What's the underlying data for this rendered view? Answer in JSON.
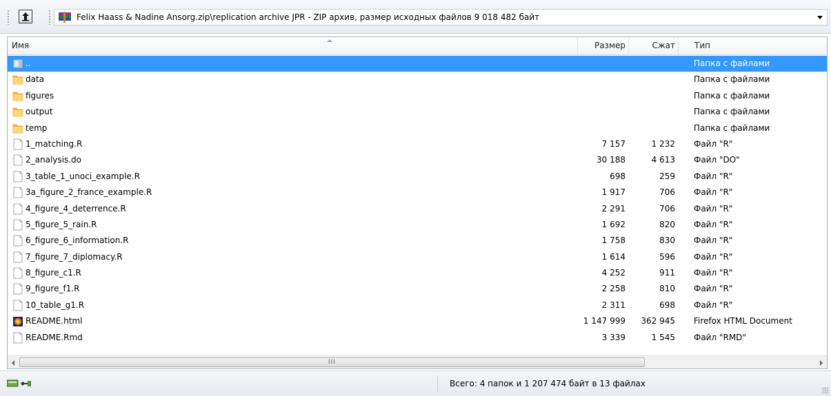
{
  "toolbar": {
    "path": "Felix Haass & Nadine Ansorg.zip\\replication archive JPR - ZIP архив, размер исходных файлов 9 018 482 байт",
    "up_icon": "up-folder-icon",
    "archive_icon": "winrar-archive-icon"
  },
  "columns": {
    "name": "Имя",
    "size": "Размер",
    "packed": "Сжат",
    "type": "Тип"
  },
  "files": [
    {
      "name": "..",
      "size": "",
      "packed": "",
      "type": "Папка с файлами",
      "icon": "parent-folder-icon",
      "selected": true
    },
    {
      "name": "data",
      "size": "",
      "packed": "",
      "type": "Папка с файлами",
      "icon": "folder-icon"
    },
    {
      "name": "figures",
      "size": "",
      "packed": "",
      "type": "Папка с файлами",
      "icon": "folder-icon"
    },
    {
      "name": "output",
      "size": "",
      "packed": "",
      "type": "Папка с файлами",
      "icon": "folder-icon"
    },
    {
      "name": "temp",
      "size": "",
      "packed": "",
      "type": "Папка с файлами",
      "icon": "folder-icon"
    },
    {
      "name": "1_matching.R",
      "size": "7 157",
      "packed": "1 232",
      "type": "Файл \"R\"",
      "icon": "file-icon"
    },
    {
      "name": "2_analysis.do",
      "size": "30 188",
      "packed": "4 613",
      "type": "Файл \"DO\"",
      "icon": "file-icon"
    },
    {
      "name": "3_table_1_unoci_example.R",
      "size": "698",
      "packed": "259",
      "type": "Файл \"R\"",
      "icon": "file-icon"
    },
    {
      "name": "3a_figure_2_france_example.R",
      "size": "1 917",
      "packed": "706",
      "type": "Файл \"R\"",
      "icon": "file-icon"
    },
    {
      "name": "4_figure_4_deterrence.R",
      "size": "2 291",
      "packed": "706",
      "type": "Файл \"R\"",
      "icon": "file-icon"
    },
    {
      "name": "5_figure_5_rain.R",
      "size": "1 692",
      "packed": "820",
      "type": "Файл \"R\"",
      "icon": "file-icon"
    },
    {
      "name": "6_figure_6_information.R",
      "size": "1 758",
      "packed": "830",
      "type": "Файл \"R\"",
      "icon": "file-icon"
    },
    {
      "name": "7_figure_7_diplomacy.R",
      "size": "1 614",
      "packed": "596",
      "type": "Файл \"R\"",
      "icon": "file-icon"
    },
    {
      "name": "8_figure_c1.R",
      "size": "4 252",
      "packed": "911",
      "type": "Файл \"R\"",
      "icon": "file-icon"
    },
    {
      "name": "9_figure_f1.R",
      "size": "2 258",
      "packed": "810",
      "type": "Файл \"R\"",
      "icon": "file-icon"
    },
    {
      "name": "10_table_g1.R",
      "size": "2 311",
      "packed": "698",
      "type": "Файл \"R\"",
      "icon": "file-icon"
    },
    {
      "name": "README.html",
      "size": "1 147 999",
      "packed": "362 945",
      "type": "Firefox HTML Document",
      "icon": "firefox-html-icon"
    },
    {
      "name": "README.Rmd",
      "size": "3 339",
      "packed": "1 545",
      "type": "Файл \"RMD\"",
      "icon": "file-icon"
    }
  ],
  "scrollbar": {
    "grip": "III"
  },
  "status": {
    "text": "Всего: 4 папок и 1 207 474 байт в 13 файлах",
    "icons": [
      "drive-icon",
      "key-icon"
    ]
  },
  "colors": {
    "selection": "#3399ff",
    "folder": "#f0c24a"
  }
}
